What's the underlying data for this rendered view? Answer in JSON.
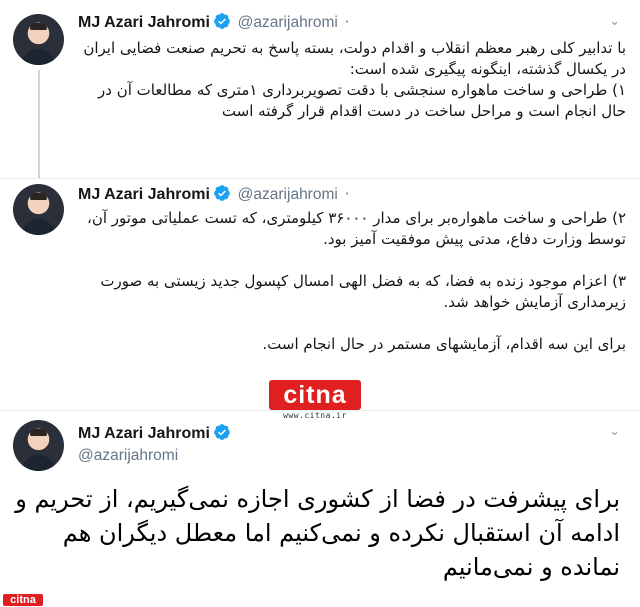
{
  "tweets": [
    {
      "name": "MJ Azari Jahromi",
      "handle": "@azarijahromi",
      "separator": "·",
      "text": "با تدابیر کلی رهبر معظم انقلاب و اقدام دولت، بسته پاسخ به تحریم صنعت فضایی ایران در یکسال گذشته، اینگونه پیگیری شده است:\n۱) طراحی و ساخت ماهواره سنجشی با دقت تصویربرداری ۱متری که مطالعات آن در حال انجام است و مراحل ساخت در دست اقدام قرار گرفته است"
    },
    {
      "name": "MJ Azari Jahromi",
      "handle": "@azarijahromi",
      "separator": "·",
      "text": "۲) طراحی و ساخت ماهواره‌بر برای مدار ۳۶۰۰۰ کیلومتری، که تست عملیاتی موتور آن، توسط وزارت دفاع، مدتی پیش موفقیت آمیز بود.\n\n۳) اعزام موجود زنده به فضا، که به فضل الهی امسال کپسول جدید زیستی به صورت زیرمداری آزمایش خواهد شد.\n\nبرای این سه اقدام، آزمایشهای مستمر در حال انجام است."
    },
    {
      "name": "MJ Azari Jahromi",
      "handle": "@azarijahromi",
      "text": "برای پیشرفت در فضا از کشوری اجازه نمی‌گیریم، از تحریم و ادامه آن استقبال نکرده و نمی‌کنیم اما معطل دیگران هم نمانده و نمی‌مانیم"
    }
  ],
  "watermark": {
    "logo_text": "citna",
    "url": "www.citna.ir",
    "corner_text": "citna"
  },
  "icons": {
    "chevron": "chevron-down-icon",
    "verified": "verified-badge-icon"
  },
  "colors": {
    "verified": "#1da1f2",
    "handle": "#657786",
    "brand_red": "#e02020"
  }
}
